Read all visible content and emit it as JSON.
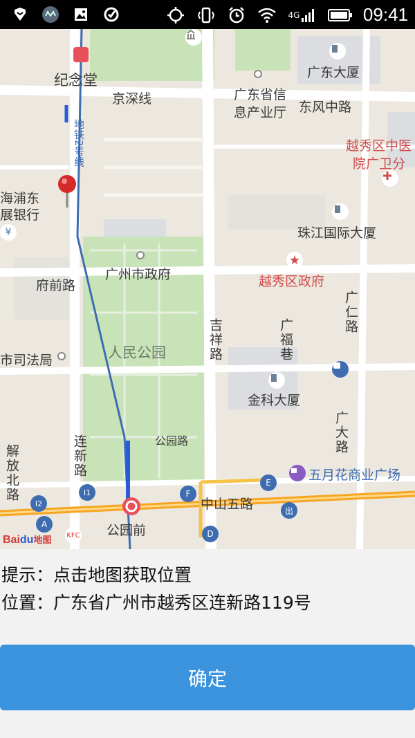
{
  "status_bar": {
    "time": "09:41",
    "network": "4G",
    "icons": [
      "shield-icon",
      "app-icon",
      "image-icon",
      "check-icon",
      "gps-icon",
      "vibrate-icon",
      "alarm-icon",
      "wifi-icon",
      "signal-icon",
      "battery-icon"
    ]
  },
  "map": {
    "labels": {
      "jinian_tang": "纪念堂",
      "jingshen_line": "京深线",
      "guangdong_xinxi": "广东省信",
      "guangdong_xinxi2": "息产业厅",
      "dongfeng_road": "东风中路",
      "guangdong_dasha": "广东大厦",
      "yuexiu_hospital": "越秀区中医",
      "yuexiu_hospital2": "院广卫分",
      "metro_line2": "地铁2号线",
      "pufa_bank": "海浦东",
      "pufa_bank2": "展银行",
      "zhujiang_tower": "珠江国际大厦",
      "gz_gov": "广州市政府",
      "yuexiu_gov": "越秀区政府",
      "fuqian_road": "府前路",
      "guangren_road": "广仁路",
      "jixiang_road": "吉祥路",
      "guangfu_alley": "广福巷",
      "people_park": "人民公园",
      "justice_bureau": "市司法局",
      "jinke_tower": "金科大厦",
      "guangda_road": "广大路",
      "gongyuan_road": "公园路",
      "lianxin_road": "连新路",
      "jiefang_north": "解放北路",
      "wuyuehua_mall": "五月花商业广场",
      "zhongshan5_road": "中山五路",
      "gongyuan_qian": "公园前",
      "exit_i1": "I1",
      "exit_i2": "I2",
      "exit_a": "A",
      "exit_d": "D",
      "exit_e": "E",
      "exit_f": "F",
      "exit_out": "出"
    },
    "logo": {
      "bai": "Bai",
      "du": "du",
      "map": "地图"
    },
    "colors": {
      "metro_line": "#3d6db0",
      "main_road": "#f6a623",
      "park": "#c9e3b8",
      "pin": "#d42a2a"
    }
  },
  "info": {
    "hint": "提示：点击地图获取位置",
    "location": "位置：广东省广州市越秀区连新路119号"
  },
  "confirm_button": {
    "label": "确定"
  }
}
